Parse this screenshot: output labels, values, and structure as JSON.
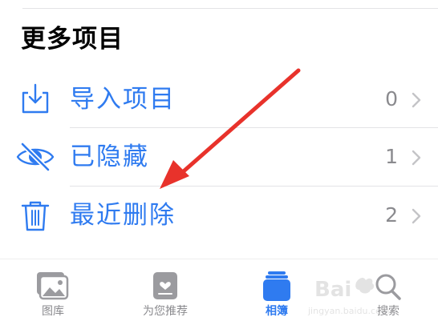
{
  "section": {
    "title": "更多项目"
  },
  "rows": [
    {
      "label": "导入项目",
      "count": "0",
      "icon": "import-icon"
    },
    {
      "label": "已隐藏",
      "count": "1",
      "icon": "eye-slash-icon"
    },
    {
      "label": "最近删除",
      "count": "2",
      "icon": "trash-icon"
    }
  ],
  "tabs": [
    {
      "label": "图库",
      "icon": "photo-library-icon",
      "active": false
    },
    {
      "label": "为您推荐",
      "icon": "for-you-icon",
      "active": false
    },
    {
      "label": "相簿",
      "icon": "albums-icon",
      "active": true
    },
    {
      "label": "搜索",
      "icon": "search-icon",
      "active": false
    }
  ],
  "colors": {
    "accent": "#2f7bf0",
    "annotation_arrow": "#e8322b",
    "secondary_text": "#8a8a8e",
    "divider": "#e3e3e6"
  },
  "watermark": {
    "text_top": "Bai",
    "text_bottom": "jingyan.baidu.com"
  }
}
